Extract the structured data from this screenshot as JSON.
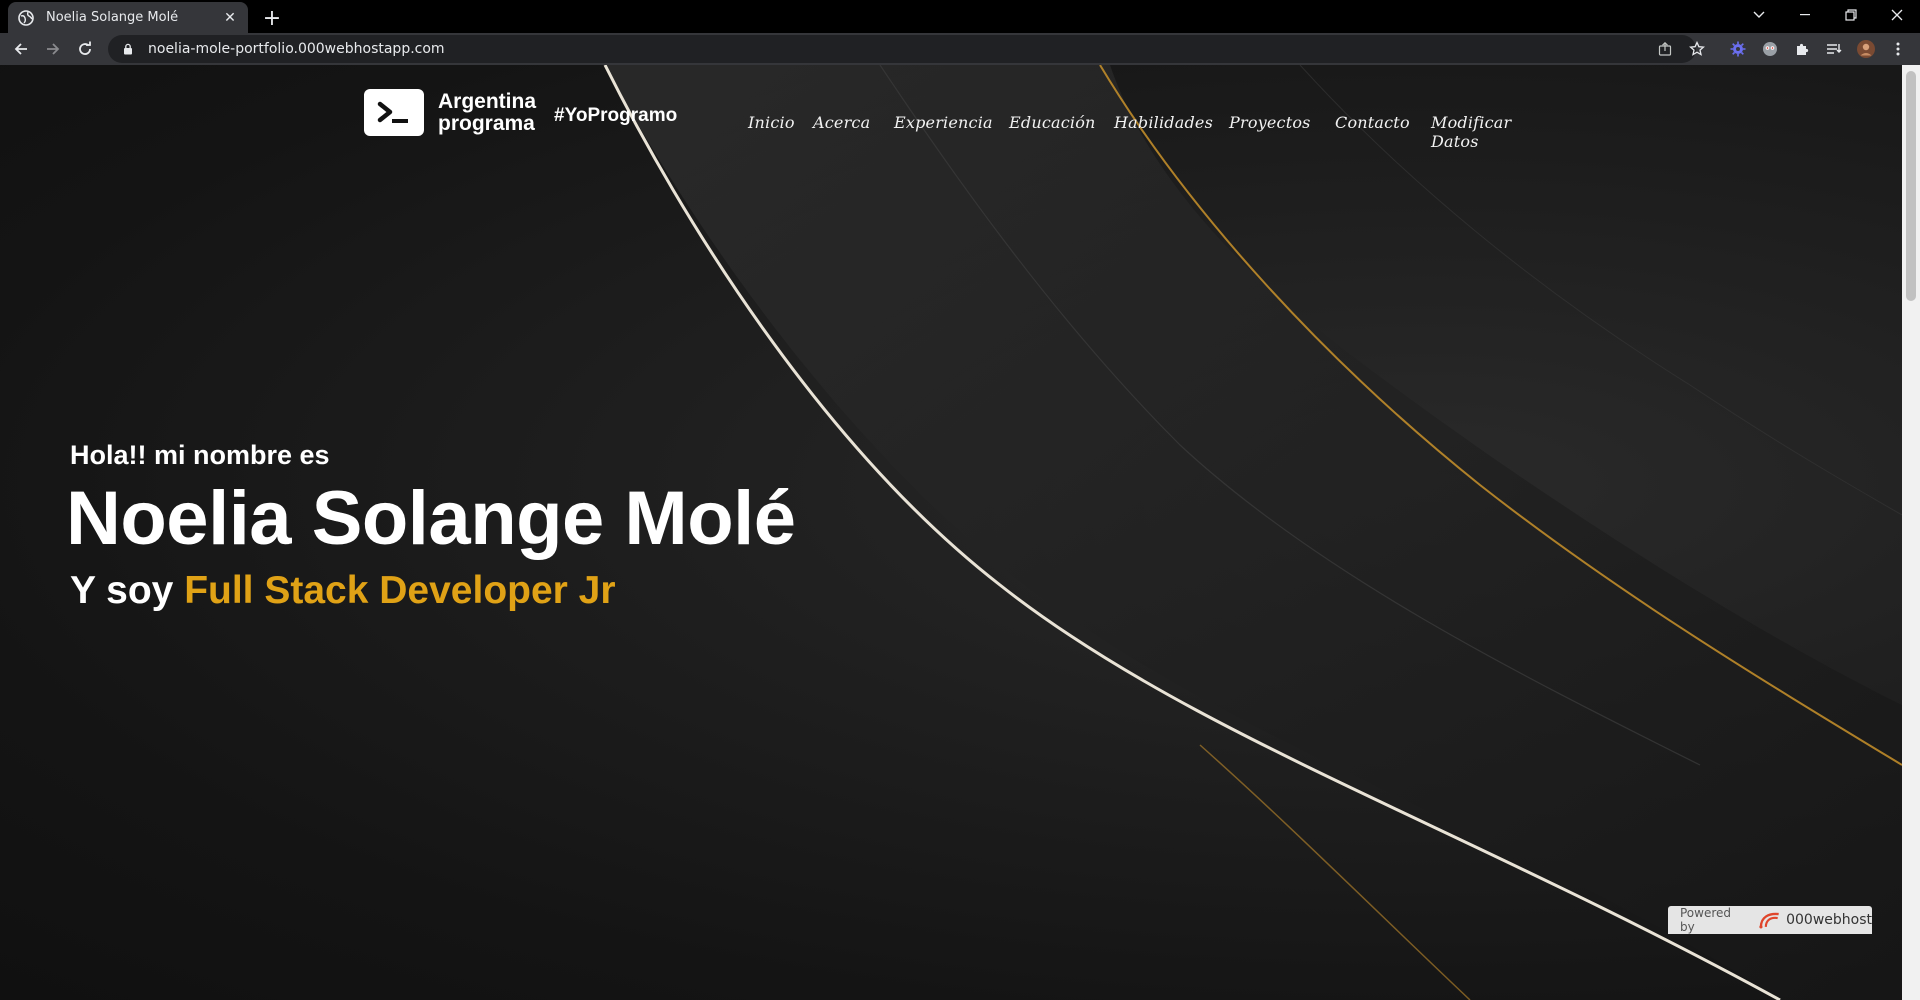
{
  "browser": {
    "tab_title": "Noelia Solange Molé",
    "new_tab_symbol": "+",
    "url": "noelia-mole-portfolio.000webhostapp.com"
  },
  "header": {
    "logo_line1": "Argentina",
    "logo_line2": "programa",
    "hashtag": "#YoProgramo",
    "nav": [
      "Inicio",
      "Acerca",
      "Experiencia",
      "Educación",
      "Habilidades",
      "Proyectos",
      "Contacto",
      "Modificar Datos"
    ]
  },
  "hero": {
    "intro": "Hola!! mi nombre es",
    "name": "Noelia Solange Molé",
    "role_prefix": "Y soy ",
    "role_highlight": "Full Stack Developer Jr"
  },
  "footer_badge": {
    "powered": "Powered by",
    "brand": "000webhost"
  },
  "colors": {
    "accent": "#e0a216",
    "background": "#1a1a1a"
  }
}
